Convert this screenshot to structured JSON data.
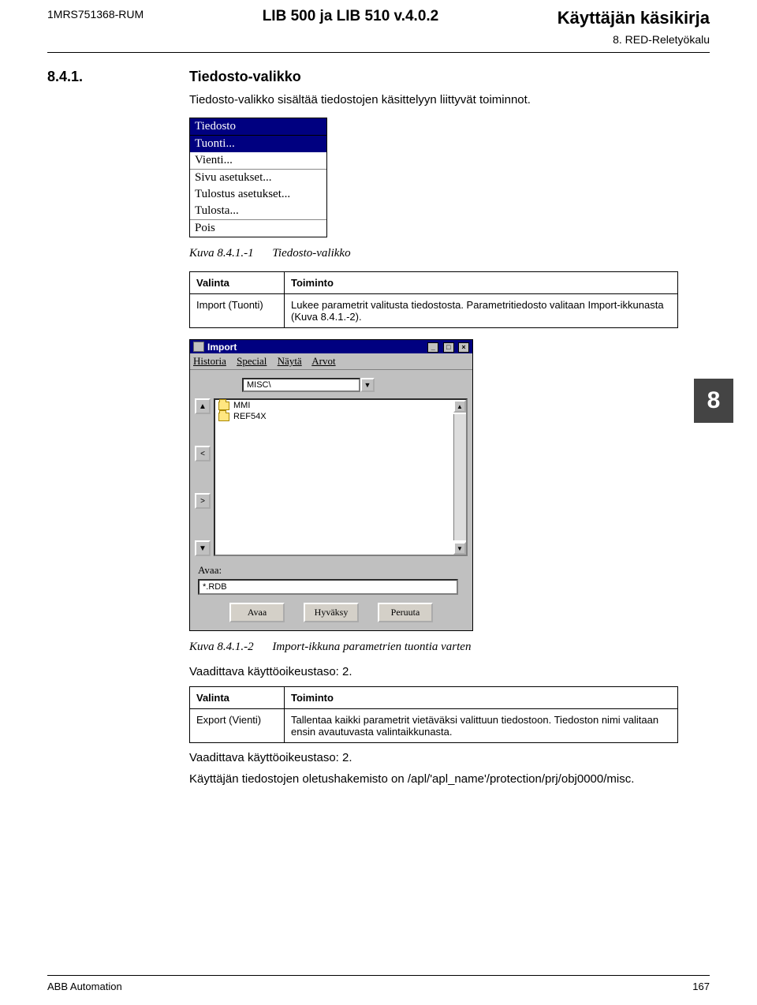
{
  "header": {
    "doc_id": "1MRS751368-RUM",
    "center_title": "LIB 500 ja LIB 510 v.4.0.2",
    "right_title": "Käyttäjän käsikirja",
    "sub_right": "8. RED-Reletyökalu"
  },
  "section": {
    "number": "8.4.1.",
    "heading": "Tiedosto-valikko",
    "intro": "Tiedosto-valikko sisältää tiedostojen käsittelyyn liittyvät toiminnot."
  },
  "menu": {
    "title": "Tiedosto",
    "highlight": "Tuonti...",
    "items": [
      "Vienti...",
      "Sivu asetukset...",
      "Tulostus asetukset...",
      "Tulosta...",
      "Pois"
    ]
  },
  "caption1": {
    "num": "Kuva 8.4.1.-1",
    "text": "Tiedosto-valikko"
  },
  "table1": {
    "h1": "Valinta",
    "h2": "Toiminto",
    "r1c1": "Import (Tuonti)",
    "r1c2": "Lukee parametrit valitusta tiedostosta. Parametritiedosto valitaan Import-ikkunasta (Kuva 8.4.1.-2)."
  },
  "chapter_tab": "8",
  "import_win": {
    "title": "Import",
    "menubar": [
      "Historia",
      "Special",
      "Näytä",
      "Arvot"
    ],
    "path": "MISC\\",
    "files": [
      "MMI",
      "REF54X"
    ],
    "open_label": "Avaa:",
    "open_value": "*.RDB",
    "buttons": [
      "Avaa",
      "Hyväksy",
      "Peruuta"
    ]
  },
  "caption2": {
    "num": "Kuva 8.4.1.-2",
    "text": "Import-ikkuna parametrien tuontia varten"
  },
  "req1": "Vaadittava käyttöoikeustaso: 2.",
  "table2": {
    "h1": "Valinta",
    "h2": "Toiminto",
    "r1c1": "Export (Vienti)",
    "r1c2": "Tallentaa kaikki parametrit vietäväksi valittuun tiedostoon. Tiedoston nimi valitaan ensin avautuvasta valintaikkunasta."
  },
  "req2": "Vaadittava käyttöoikeustaso: 2.",
  "para_last": "Käyttäjän tiedostojen oletushakemisto on /apl/'apl_name'/protection/prj/obj0000/misc.",
  "footer": {
    "left": "ABB Automation",
    "right": "167"
  }
}
